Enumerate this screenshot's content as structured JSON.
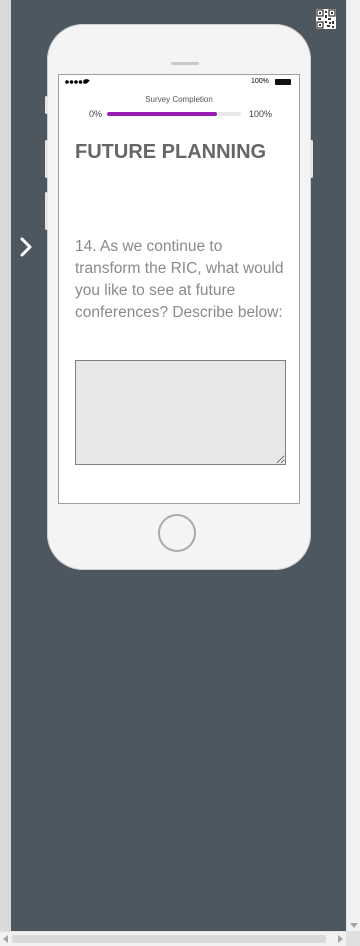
{
  "status_bar": {
    "battery_percent": "100%"
  },
  "progress": {
    "label": "Survey Completion",
    "start_label": "0%",
    "end_label": "100%",
    "value_fraction": 0.82,
    "fill_color": "#9a1ab5"
  },
  "section": {
    "title": "FUTURE PLANNING"
  },
  "question": {
    "text": "14. As we continue to transform the RIC, what would you like to see at future conferences?  Describe below:"
  },
  "answer": {
    "value": ""
  },
  "icons": {
    "qr": "qr-code-icon",
    "next": "chevron-right-icon",
    "home": "home-button"
  },
  "colors": {
    "background": "#4c5760",
    "phone_body": "#f4f4f4",
    "accent": "#9a1ab5"
  }
}
